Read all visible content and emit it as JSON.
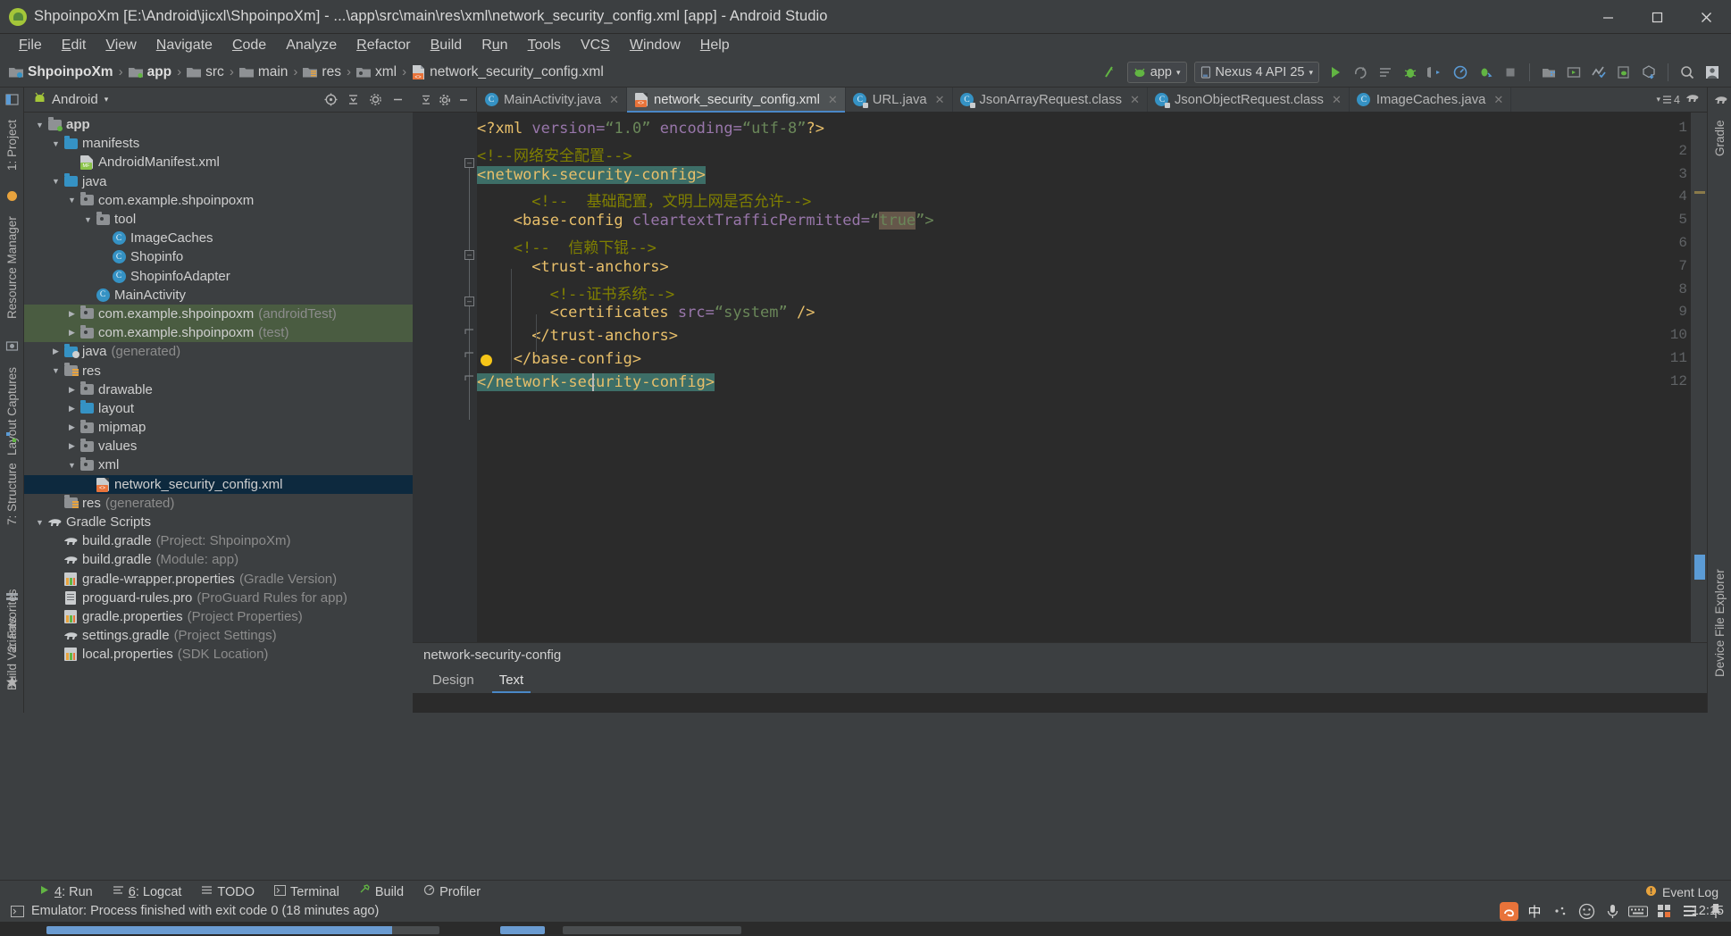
{
  "window": {
    "title": "ShpoinpoXm [E:\\Android\\jicxl\\ShpoinpoXm] - ...\\app\\src\\main\\res\\xml\\network_security_config.xml [app] - Android Studio",
    "app_icon": "android-studio-icon",
    "minimize_label": "–",
    "maximize_label": "□",
    "close_label": "✕"
  },
  "menu": [
    {
      "pre": "",
      "mn": "F",
      "post": "ile"
    },
    {
      "pre": "",
      "mn": "E",
      "post": "dit"
    },
    {
      "pre": "",
      "mn": "V",
      "post": "iew"
    },
    {
      "pre": "",
      "mn": "N",
      "post": "avigate"
    },
    {
      "pre": "",
      "mn": "C",
      "post": "ode"
    },
    {
      "pre": "Anal",
      "mn": "y",
      "post": "ze"
    },
    {
      "pre": "",
      "mn": "R",
      "post": "efactor"
    },
    {
      "pre": "",
      "mn": "B",
      "post": "uild"
    },
    {
      "pre": "R",
      "mn": "u",
      "post": "n"
    },
    {
      "pre": "",
      "mn": "T",
      "post": "ools"
    },
    {
      "pre": "VC",
      "mn": "S",
      "post": ""
    },
    {
      "pre": "",
      "mn": "W",
      "post": "indow"
    },
    {
      "pre": "",
      "mn": "H",
      "post": "elp"
    }
  ],
  "breadcrumb": {
    "separator": "›",
    "items": [
      {
        "label": "ShpoinpoXm",
        "icon": "project-module-icon",
        "bold": true
      },
      {
        "label": "app",
        "icon": "module-folder-icon",
        "bold": true
      },
      {
        "label": "src",
        "icon": "folder-icon",
        "bold": false
      },
      {
        "label": "main",
        "icon": "folder-icon",
        "bold": false
      },
      {
        "label": "res",
        "icon": "res-folder-icon",
        "bold": false
      },
      {
        "label": "xml",
        "icon": "package-folder-icon",
        "bold": false
      },
      {
        "label": "network_security_config.xml",
        "icon": "xml-file-icon",
        "bold": false
      }
    ]
  },
  "toolbar": {
    "module_selector": "app",
    "device_selector": "Nexus 4 API 25",
    "caret": "▾",
    "icons": [
      "sync-project-icon",
      "run-icon",
      "apply-changes-icon",
      "run-config-icon",
      "debug-icon",
      "attach-debugger-icon",
      "profiler-icon",
      "coverage-icon",
      "stop-icon",
      "sdk-manager-icon",
      "avd-manager-icon",
      "layout-inspector-icon",
      "device-file-explorer-icon",
      "build-apk-icon",
      "search-icon",
      "avatar-icon"
    ]
  },
  "left_strips": [
    {
      "label": "1: Project",
      "icon": "project-icon"
    },
    {
      "label": "Resource Manager",
      "icon": "resource-icon"
    },
    {
      "label": "Layout Captures",
      "icon": "capture-icon"
    },
    {
      "label": "7: Structure",
      "icon": "structure-icon"
    },
    {
      "label": "2: Favorites",
      "icon": "star-icon"
    },
    {
      "label": "Build Variants",
      "icon": "variants-icon"
    }
  ],
  "right_strips": [
    {
      "label": "Gradle",
      "icon": "gradle-icon"
    },
    {
      "label": "Device File Explorer",
      "icon": "device-explorer-icon"
    }
  ],
  "project_panel": {
    "view_name": "Android",
    "caret": "▾",
    "header_icons": [
      "target-icon",
      "collapse-all-icon",
      "settings-icon",
      "hide-icon"
    ],
    "tree": [
      {
        "depth": 0,
        "arrow": "down",
        "icon": "module-folder-icon",
        "label": "app",
        "bold": true,
        "dim": "",
        "state": "normal"
      },
      {
        "depth": 1,
        "arrow": "down",
        "icon": "blue-folder-icon",
        "label": "manifests",
        "bold": false,
        "dim": "",
        "state": "normal"
      },
      {
        "depth": 2,
        "arrow": "none",
        "icon": "manifest-file-icon",
        "label": "AndroidManifest.xml",
        "bold": false,
        "dim": "",
        "state": "normal"
      },
      {
        "depth": 1,
        "arrow": "down",
        "icon": "blue-folder-icon",
        "label": "java",
        "bold": false,
        "dim": "",
        "state": "normal"
      },
      {
        "depth": 2,
        "arrow": "down",
        "icon": "package-folder-icon",
        "label": "com.example.shpoinpoxm",
        "bold": false,
        "dim": "",
        "state": "normal"
      },
      {
        "depth": 3,
        "arrow": "down",
        "icon": "package-folder-icon",
        "label": "tool",
        "bold": false,
        "dim": "",
        "state": "normal"
      },
      {
        "depth": 4,
        "arrow": "none",
        "icon": "java-class-icon",
        "label": "ImageCaches",
        "bold": false,
        "dim": "",
        "state": "normal"
      },
      {
        "depth": 4,
        "arrow": "none",
        "icon": "java-class-icon",
        "label": "Shopinfo",
        "bold": false,
        "dim": "",
        "state": "normal"
      },
      {
        "depth": 4,
        "arrow": "none",
        "icon": "java-class-icon",
        "label": "ShopinfoAdapter",
        "bold": false,
        "dim": "",
        "state": "normal"
      },
      {
        "depth": 3,
        "arrow": "none",
        "icon": "java-class-icon",
        "label": "MainActivity",
        "bold": false,
        "dim": "",
        "state": "normal"
      },
      {
        "depth": 2,
        "arrow": "right",
        "icon": "package-folder-icon",
        "label": "com.example.shpoinpoxm",
        "bold": false,
        "dim": "(androidTest)",
        "state": "green"
      },
      {
        "depth": 2,
        "arrow": "right",
        "icon": "package-folder-icon",
        "label": "com.example.shpoinpoxm",
        "bold": false,
        "dim": "(test)",
        "state": "green"
      },
      {
        "depth": 1,
        "arrow": "right",
        "icon": "generated-folder-icon",
        "label": "java",
        "bold": false,
        "dim": "(generated)",
        "state": "normal"
      },
      {
        "depth": 1,
        "arrow": "down",
        "icon": "res-folder-icon",
        "label": "res",
        "bold": false,
        "dim": "",
        "state": "normal"
      },
      {
        "depth": 2,
        "arrow": "right",
        "icon": "package-folder-icon",
        "label": "drawable",
        "bold": false,
        "dim": "",
        "state": "normal"
      },
      {
        "depth": 2,
        "arrow": "right",
        "icon": "blue-folder-icon",
        "label": "layout",
        "bold": false,
        "dim": "",
        "state": "normal"
      },
      {
        "depth": 2,
        "arrow": "right",
        "icon": "package-folder-icon",
        "label": "mipmap",
        "bold": false,
        "dim": "",
        "state": "normal"
      },
      {
        "depth": 2,
        "arrow": "right",
        "icon": "package-folder-icon",
        "label": "values",
        "bold": false,
        "dim": "",
        "state": "normal"
      },
      {
        "depth": 2,
        "arrow": "down",
        "icon": "package-folder-icon",
        "label": "xml",
        "bold": false,
        "dim": "",
        "state": "normal"
      },
      {
        "depth": 3,
        "arrow": "none",
        "icon": "xml-file-icon",
        "label": "network_security_config.xml",
        "bold": false,
        "dim": "",
        "state": "selected"
      },
      {
        "depth": 1,
        "arrow": "none",
        "icon": "res-folder-icon",
        "label": "res",
        "bold": false,
        "dim": "(generated)",
        "state": "normal"
      },
      {
        "depth": 0,
        "arrow": "down",
        "icon": "gradle-icon",
        "label": "Gradle Scripts",
        "bold": false,
        "dim": "",
        "state": "normal"
      },
      {
        "depth": 1,
        "arrow": "none",
        "icon": "gradle-icon",
        "label": "build.gradle",
        "bold": false,
        "dim": "(Project: ShpoinpoXm)",
        "state": "normal"
      },
      {
        "depth": 1,
        "arrow": "none",
        "icon": "gradle-icon",
        "label": "build.gradle",
        "bold": false,
        "dim": "(Module: app)",
        "state": "normal"
      },
      {
        "depth": 1,
        "arrow": "none",
        "icon": "properties-file-icon",
        "label": "gradle-wrapper.properties",
        "bold": false,
        "dim": "(Gradle Version)",
        "state": "normal"
      },
      {
        "depth": 1,
        "arrow": "none",
        "icon": "proguard-file-icon",
        "label": "proguard-rules.pro",
        "bold": false,
        "dim": "(ProGuard Rules for app)",
        "state": "normal"
      },
      {
        "depth": 1,
        "arrow": "none",
        "icon": "properties-file-icon",
        "label": "gradle.properties",
        "bold": false,
        "dim": "(Project Properties)",
        "state": "normal"
      },
      {
        "depth": 1,
        "arrow": "none",
        "icon": "gradle-icon",
        "label": "settings.gradle",
        "bold": false,
        "dim": "(Project Settings)",
        "state": "normal"
      },
      {
        "depth": 1,
        "arrow": "none",
        "icon": "properties-file-icon",
        "label": "local.properties",
        "bold": false,
        "dim": "(SDK Location)",
        "state": "normal"
      }
    ]
  },
  "editor": {
    "tab_controls": [
      "collapse-icon",
      "settings-icon",
      "hide-icon"
    ],
    "tabs": [
      {
        "label": "MainActivity.java",
        "icon": "java-class-icon",
        "active": false,
        "close": "✕"
      },
      {
        "label": "network_security_config.xml",
        "icon": "xml-file-icon",
        "active": true,
        "close": "✕"
      },
      {
        "label": "URL.java",
        "icon": "java-class-locked-icon",
        "active": false,
        "close": "✕"
      },
      {
        "label": "JsonArrayRequest.class",
        "icon": "java-class-locked-icon",
        "active": false,
        "close": "✕"
      },
      {
        "label": "JsonObjectRequest.class",
        "icon": "java-class-locked-icon",
        "active": false,
        "close": "✕"
      },
      {
        "label": "ImageCaches.java",
        "icon": "java-class-icon",
        "active": false,
        "close": "✕"
      }
    ],
    "tab_overflow_count": "4",
    "lines": [
      {
        "n": "1",
        "indent": 0,
        "segments": [
          {
            "t": "<?xml ",
            "c": "tok-pi"
          },
          {
            "t": "version=",
            "c": "tok-attr"
          },
          {
            "t": "“1.0”",
            "c": "tok-str"
          },
          {
            "t": " encoding=",
            "c": "tok-attr"
          },
          {
            "t": "“utf-8”",
            "c": "tok-str"
          },
          {
            "t": "?>",
            "c": "tok-pi"
          }
        ]
      },
      {
        "n": "2",
        "indent": 0,
        "segments": [
          {
            "t": "<!--网络安全配置-->",
            "c": "tok-cmt"
          }
        ]
      },
      {
        "n": "3",
        "indent": 0,
        "segments": [
          {
            "t": "<network-security-config>",
            "c": "tok-tag sel-bg"
          }
        ]
      },
      {
        "n": "4",
        "indent": 3,
        "segments": [
          {
            "t": "<!--  基础配置，文明上网是否允许-->",
            "c": "tok-cmt"
          }
        ]
      },
      {
        "n": "5",
        "indent": 2,
        "segments": [
          {
            "t": "<base-config ",
            "c": "tok-tag"
          },
          {
            "t": "cleartextTrafficPermitted=",
            "c": "tok-attr"
          },
          {
            "t": "“",
            "c": "tok-str"
          },
          {
            "t": "true",
            "c": "tok-str val-bg"
          },
          {
            "t": "”>",
            "c": "tok-str"
          }
        ]
      },
      {
        "n": "6",
        "indent": 2,
        "segments": [
          {
            "t": "<!--  信赖下锟-->",
            "c": "tok-cmt"
          }
        ]
      },
      {
        "n": "7",
        "indent": 3,
        "segments": [
          {
            "t": "<trust-anchors>",
            "c": "tok-tag"
          }
        ]
      },
      {
        "n": "8",
        "indent": 4,
        "segments": [
          {
            "t": "<!--证书系统-->",
            "c": "tok-cmt"
          }
        ]
      },
      {
        "n": "9",
        "indent": 4,
        "segments": [
          {
            "t": "<certificates ",
            "c": "tok-tag"
          },
          {
            "t": "src=",
            "c": "tok-attr"
          },
          {
            "t": "“system”",
            "c": "tok-str"
          },
          {
            "t": " />",
            "c": "tok-tag"
          }
        ]
      },
      {
        "n": "10",
        "indent": 3,
        "segments": [
          {
            "t": "</trust-anchors>",
            "c": "tok-tag"
          }
        ]
      },
      {
        "n": "11",
        "indent": 2,
        "segments": [
          {
            "t": "</base-config>",
            "c": "tok-tag"
          }
        ]
      },
      {
        "n": "12",
        "indent": 0,
        "segments": [
          {
            "t": "</network-security-config>",
            "c": "tok-tag sel-bg"
          }
        ]
      }
    ],
    "status_hint": "network-security-config",
    "design_tabs": [
      {
        "label": "Design",
        "active": false
      },
      {
        "label": "Text",
        "active": true
      }
    ]
  },
  "bottom_tools": [
    {
      "label_pre": "",
      "label_mn": "4",
      "label_post": ": Run",
      "icon": "run-icon"
    },
    {
      "label_pre": "",
      "label_mn": "6",
      "label_post": ": Logcat",
      "icon": "logcat-icon"
    },
    {
      "label_pre": "TODO",
      "label_mn": "",
      "label_post": "",
      "icon": "todo-icon"
    },
    {
      "label_pre": "Terminal",
      "label_mn": "",
      "label_post": "",
      "icon": "terminal-icon"
    },
    {
      "label_pre": "Build",
      "label_mn": "",
      "label_post": "",
      "icon": "build-icon"
    },
    {
      "label_pre": "Profiler",
      "label_mn": "",
      "label_post": "",
      "icon": "profiler-icon"
    }
  ],
  "bottom_right": {
    "label": "Event Log",
    "icon": "event-log-icon"
  },
  "status": {
    "message": "Emulator: Process finished with exit code 0 (18 minutes ago)",
    "icon": "terminal-status-icon",
    "time": "12:15",
    "ime_label": "中",
    "tray_icons": [
      "sogou-icon",
      "ime-chinese-icon",
      "ime-dot-icon",
      "emoji-icon",
      "mic-icon",
      "keyboard-icon",
      "grid-icon",
      "more-icon",
      "pin-icon"
    ]
  },
  "colors": {
    "panel_bg": "#3c3f41",
    "editor_bg": "#2b2b2b",
    "gutter_bg": "#313335",
    "accent_blue": "#4a88c7",
    "selection_teal": "#3d6e67",
    "selection_tree": "#0d293e",
    "green_row": "#4a5c41",
    "tag": "#e8bf6a",
    "attr": "#9876aa",
    "string": "#6a8759",
    "comment": "#808000"
  }
}
